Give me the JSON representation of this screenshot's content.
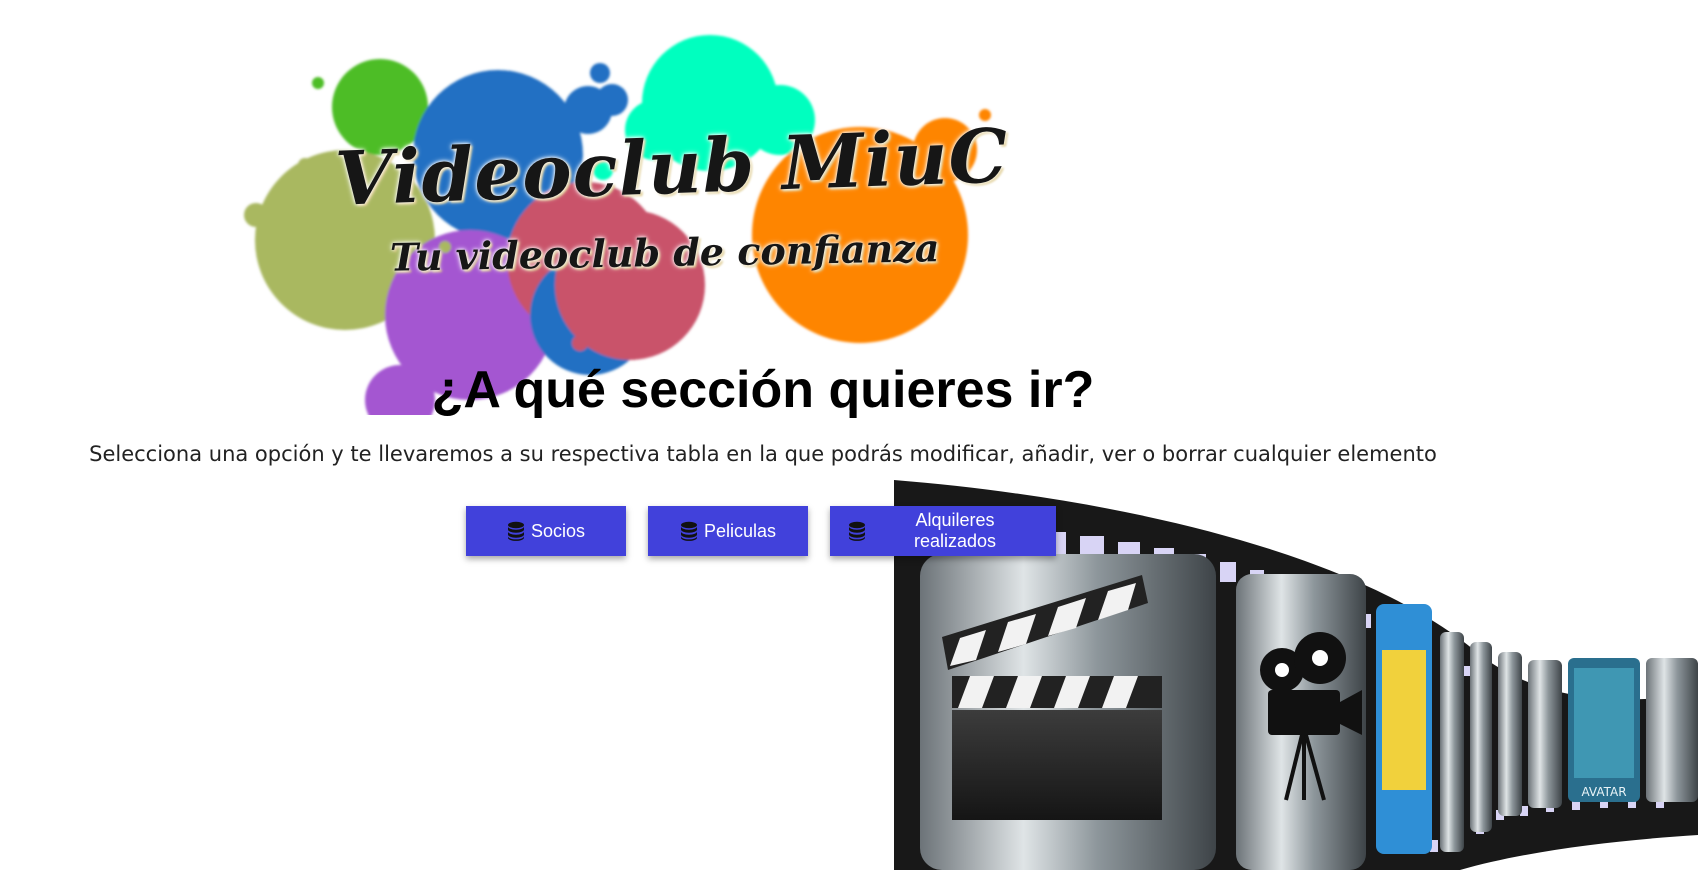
{
  "logo": {
    "title": "Videoclub MiuC",
    "tagline": "Tu videoclub de confianza"
  },
  "heading": "¿A qué sección quieres ir?",
  "subtitle": "Selecciona una opción y te llevaremos a su respectiva tabla en la que podrás modificar, añadir, ver o borrar cualquier elemento",
  "buttons": [
    {
      "label": "Socios",
      "icon": "database-icon"
    },
    {
      "label": "Peliculas",
      "icon": "database-icon"
    },
    {
      "label": "Alquileres realizados",
      "icon": "database-icon"
    }
  ],
  "colors": {
    "button_bg": "#4141db",
    "button_text": "#ffffff"
  },
  "decoration": {
    "poster_text": "AVATAR"
  }
}
